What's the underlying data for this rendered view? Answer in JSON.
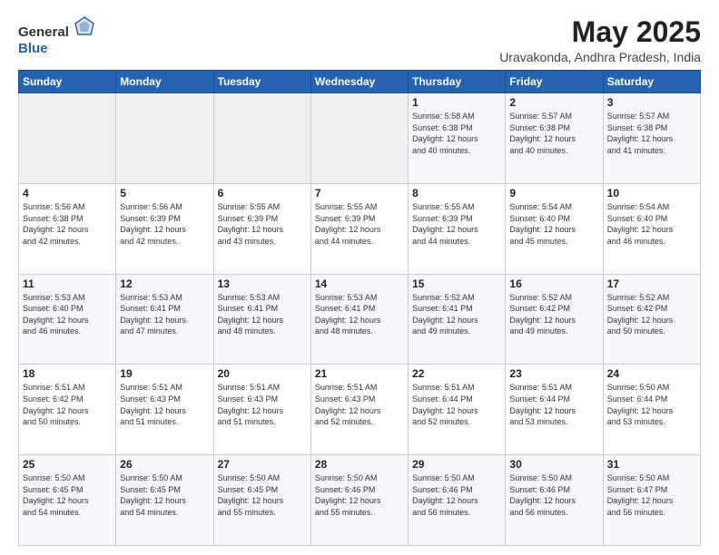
{
  "logo": {
    "text_general": "General",
    "text_blue": "Blue"
  },
  "title": "May 2025",
  "subtitle": "Uravakonda, Andhra Pradesh, India",
  "days_of_week": [
    "Sunday",
    "Monday",
    "Tuesday",
    "Wednesday",
    "Thursday",
    "Friday",
    "Saturday"
  ],
  "weeks": [
    [
      {
        "day": "",
        "info": ""
      },
      {
        "day": "",
        "info": ""
      },
      {
        "day": "",
        "info": ""
      },
      {
        "day": "",
        "info": ""
      },
      {
        "day": "1",
        "info": "Sunrise: 5:58 AM\nSunset: 6:38 PM\nDaylight: 12 hours\nand 40 minutes."
      },
      {
        "day": "2",
        "info": "Sunrise: 5:57 AM\nSunset: 6:38 PM\nDaylight: 12 hours\nand 40 minutes."
      },
      {
        "day": "3",
        "info": "Sunrise: 5:57 AM\nSunset: 6:38 PM\nDaylight: 12 hours\nand 41 minutes."
      }
    ],
    [
      {
        "day": "4",
        "info": "Sunrise: 5:56 AM\nSunset: 6:38 PM\nDaylight: 12 hours\nand 42 minutes."
      },
      {
        "day": "5",
        "info": "Sunrise: 5:56 AM\nSunset: 6:39 PM\nDaylight: 12 hours\nand 42 minutes."
      },
      {
        "day": "6",
        "info": "Sunrise: 5:55 AM\nSunset: 6:39 PM\nDaylight: 12 hours\nand 43 minutes."
      },
      {
        "day": "7",
        "info": "Sunrise: 5:55 AM\nSunset: 6:39 PM\nDaylight: 12 hours\nand 44 minutes."
      },
      {
        "day": "8",
        "info": "Sunrise: 5:55 AM\nSunset: 6:39 PM\nDaylight: 12 hours\nand 44 minutes."
      },
      {
        "day": "9",
        "info": "Sunrise: 5:54 AM\nSunset: 6:40 PM\nDaylight: 12 hours\nand 45 minutes."
      },
      {
        "day": "10",
        "info": "Sunrise: 5:54 AM\nSunset: 6:40 PM\nDaylight: 12 hours\nand 46 minutes."
      }
    ],
    [
      {
        "day": "11",
        "info": "Sunrise: 5:53 AM\nSunset: 6:40 PM\nDaylight: 12 hours\nand 46 minutes."
      },
      {
        "day": "12",
        "info": "Sunrise: 5:53 AM\nSunset: 6:41 PM\nDaylight: 12 hours\nand 47 minutes."
      },
      {
        "day": "13",
        "info": "Sunrise: 5:53 AM\nSunset: 6:41 PM\nDaylight: 12 hours\nand 48 minutes."
      },
      {
        "day": "14",
        "info": "Sunrise: 5:53 AM\nSunset: 6:41 PM\nDaylight: 12 hours\nand 48 minutes."
      },
      {
        "day": "15",
        "info": "Sunrise: 5:52 AM\nSunset: 6:41 PM\nDaylight: 12 hours\nand 49 minutes."
      },
      {
        "day": "16",
        "info": "Sunrise: 5:52 AM\nSunset: 6:42 PM\nDaylight: 12 hours\nand 49 minutes."
      },
      {
        "day": "17",
        "info": "Sunrise: 5:52 AM\nSunset: 6:42 PM\nDaylight: 12 hours\nand 50 minutes."
      }
    ],
    [
      {
        "day": "18",
        "info": "Sunrise: 5:51 AM\nSunset: 6:42 PM\nDaylight: 12 hours\nand 50 minutes."
      },
      {
        "day": "19",
        "info": "Sunrise: 5:51 AM\nSunset: 6:43 PM\nDaylight: 12 hours\nand 51 minutes."
      },
      {
        "day": "20",
        "info": "Sunrise: 5:51 AM\nSunset: 6:43 PM\nDaylight: 12 hours\nand 51 minutes."
      },
      {
        "day": "21",
        "info": "Sunrise: 5:51 AM\nSunset: 6:43 PM\nDaylight: 12 hours\nand 52 minutes."
      },
      {
        "day": "22",
        "info": "Sunrise: 5:51 AM\nSunset: 6:44 PM\nDaylight: 12 hours\nand 52 minutes."
      },
      {
        "day": "23",
        "info": "Sunrise: 5:51 AM\nSunset: 6:44 PM\nDaylight: 12 hours\nand 53 minutes."
      },
      {
        "day": "24",
        "info": "Sunrise: 5:50 AM\nSunset: 6:44 PM\nDaylight: 12 hours\nand 53 minutes."
      }
    ],
    [
      {
        "day": "25",
        "info": "Sunrise: 5:50 AM\nSunset: 6:45 PM\nDaylight: 12 hours\nand 54 minutes."
      },
      {
        "day": "26",
        "info": "Sunrise: 5:50 AM\nSunset: 6:45 PM\nDaylight: 12 hours\nand 54 minutes."
      },
      {
        "day": "27",
        "info": "Sunrise: 5:50 AM\nSunset: 6:45 PM\nDaylight: 12 hours\nand 55 minutes."
      },
      {
        "day": "28",
        "info": "Sunrise: 5:50 AM\nSunset: 6:46 PM\nDaylight: 12 hours\nand 55 minutes."
      },
      {
        "day": "29",
        "info": "Sunrise: 5:50 AM\nSunset: 6:46 PM\nDaylight: 12 hours\nand 56 minutes."
      },
      {
        "day": "30",
        "info": "Sunrise: 5:50 AM\nSunset: 6:46 PM\nDaylight: 12 hours\nand 56 minutes."
      },
      {
        "day": "31",
        "info": "Sunrise: 5:50 AM\nSunset: 6:47 PM\nDaylight: 12 hours\nand 56 minutes."
      }
    ]
  ]
}
